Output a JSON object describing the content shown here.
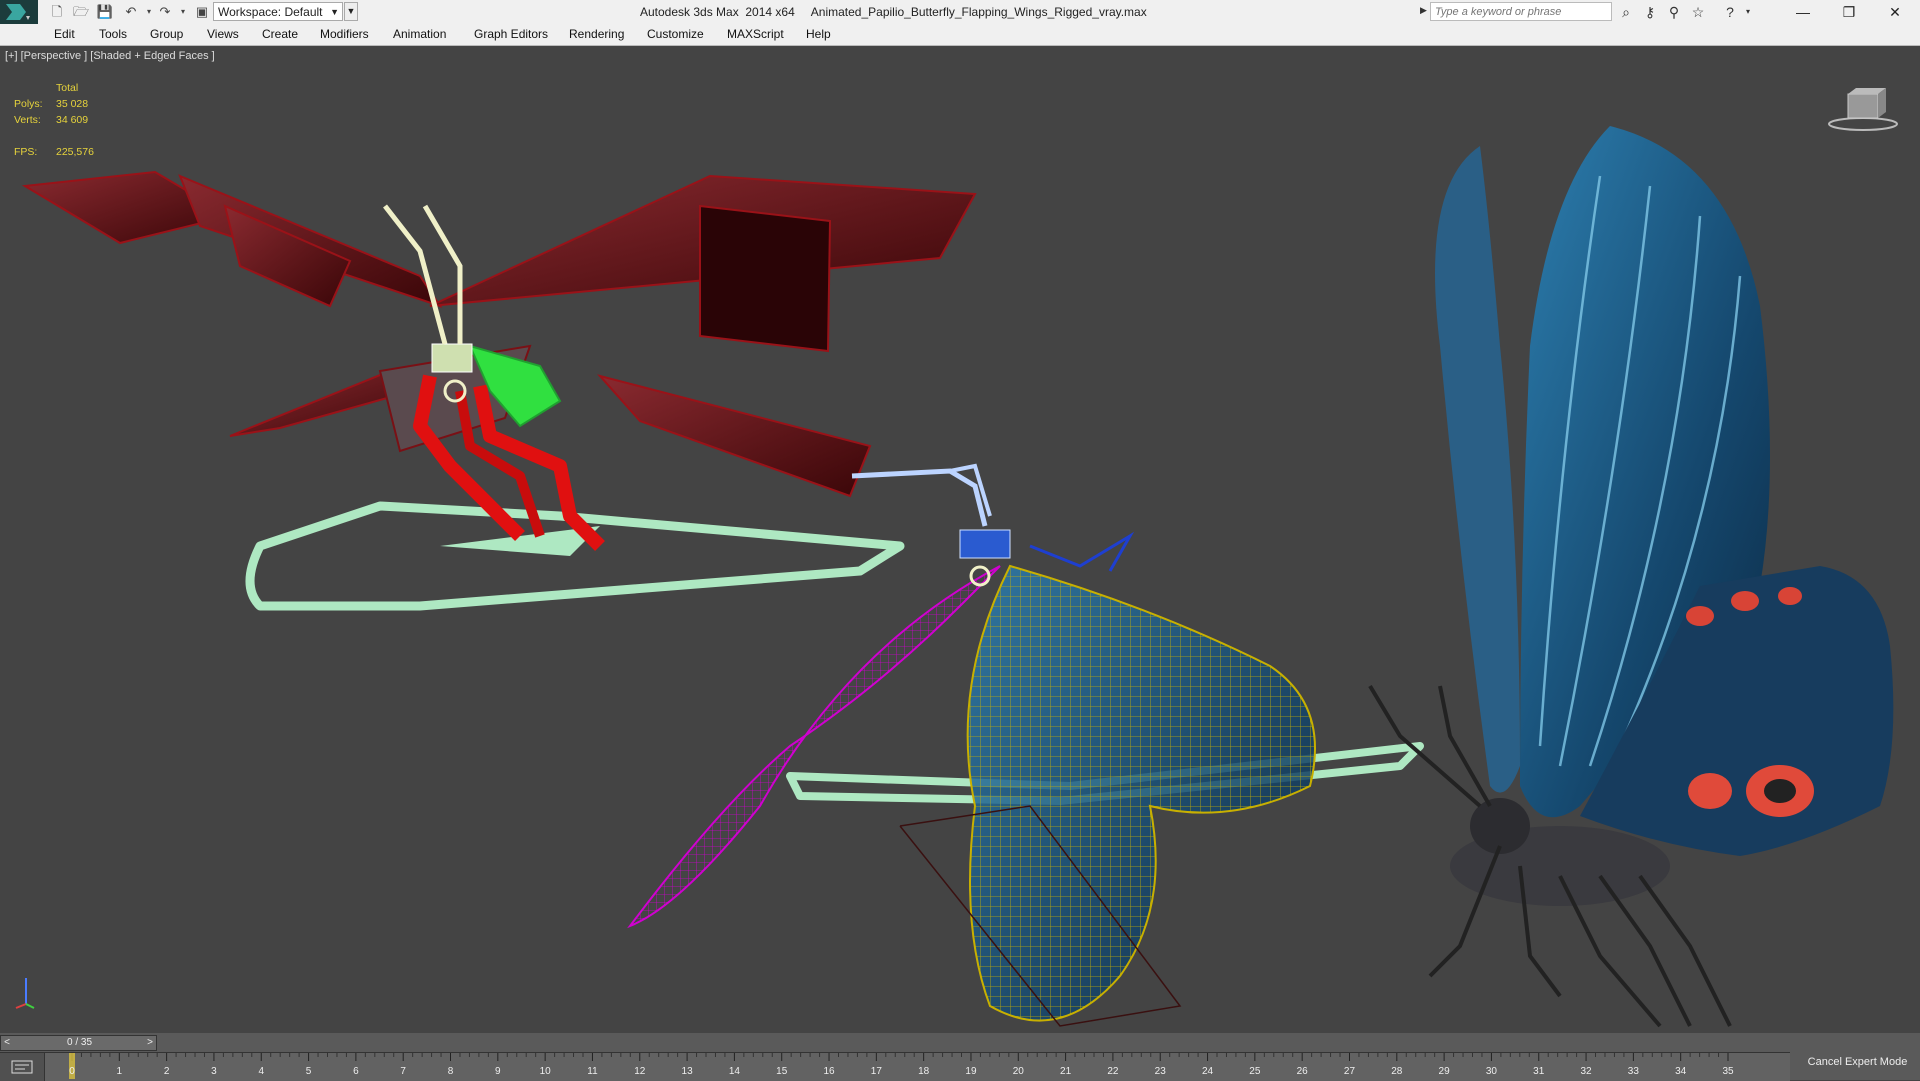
{
  "app": {
    "window_title": "Autodesk 3ds Max  2014 x64     Animated_Papilio_Butterfly_Flapping_Wings_Rigged_vray.max",
    "workspace_label": "Workspace: Default",
    "search_placeholder": "Type a keyword or phrase",
    "window_controls": {
      "minimize": "—",
      "restore": "❐",
      "close": "✕"
    }
  },
  "toolbar": {
    "new_icon": "new-file-icon",
    "open_icon": "open-folder-icon",
    "save_icon": "save-icon",
    "undo_icon": "undo-icon",
    "redo_icon": "redo-icon",
    "project_icon": "project-folder-icon"
  },
  "menu": {
    "items": [
      "Edit",
      "Tools",
      "Group",
      "Views",
      "Create",
      "Modifiers",
      "Animation",
      "Graph Editors",
      "Rendering",
      "Customize",
      "MAXScript",
      "Help"
    ]
  },
  "viewport": {
    "label": "[+] [Perspective ] [Shaded + Edged Faces ]",
    "stats": {
      "header": "Total",
      "polys_label": "Polys:",
      "polys_value": "35 028",
      "verts_label": "Verts:",
      "verts_value": "34 609",
      "fps_label": "FPS:",
      "fps_value": "225,576"
    },
    "colors": {
      "background": "#444444",
      "stats_text": "#e6d33c",
      "control_mesh_red": "#7a0f12",
      "rig_green": "#aee8c2",
      "wireframe_magenta": "#d000d0",
      "wireframe_yellow": "#c8b000",
      "wing_blue": "#1f5a8a"
    }
  },
  "timeline": {
    "slider_value": "0 / 35",
    "prev_arrow": "<",
    "next_arrow": ">",
    "ticks": [
      "0",
      "1",
      "2",
      "3",
      "4",
      "5",
      "6",
      "7",
      "8",
      "9",
      "10",
      "11",
      "12",
      "13",
      "14",
      "15",
      "16",
      "17",
      "18",
      "19",
      "20",
      "21",
      "22",
      "23",
      "24",
      "25",
      "26",
      "27",
      "28",
      "29",
      "30",
      "31",
      "32",
      "33",
      "34",
      "35"
    ],
    "expert_mode_label": "Cancel Expert Mode"
  }
}
